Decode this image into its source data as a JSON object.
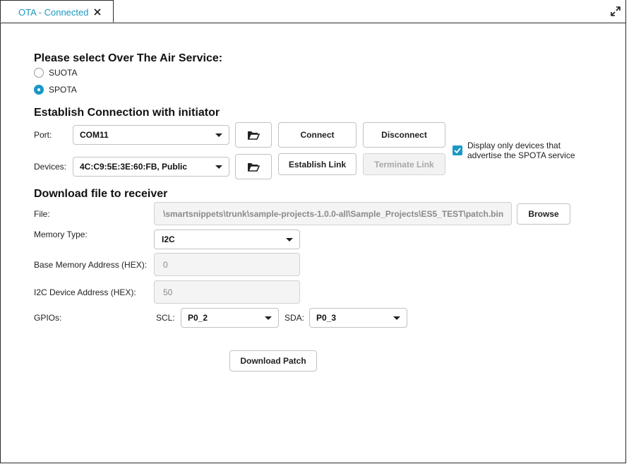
{
  "tab": {
    "title": "OTA - Connected"
  },
  "service": {
    "heading": "Please select Over The Air Service:",
    "options": [
      {
        "label": "SUOTA",
        "selected": false
      },
      {
        "label": "SPOTA",
        "selected": true
      }
    ]
  },
  "connection": {
    "heading": "Establish Connection with initiator",
    "port_label": "Port:",
    "port_value": "COM11",
    "devices_label": "Devices:",
    "devices_value": "4C:C9:5E:3E:60:FB, Public",
    "connect_label": "Connect",
    "disconnect_label": "Disconnect",
    "establish_label": "Establish Link",
    "terminate_label": "Terminate Link",
    "filter_checked": true,
    "filter_line1": "Display only devices that",
    "filter_line2": "advertise the SPOTA service"
  },
  "download": {
    "heading": "Download file to receiver",
    "file_label": "File:",
    "file_value": "\\smartsnippets\\trunk\\sample-projects-1.0.0-all\\Sample_Projects\\ES5_TEST\\patch.bin",
    "browse_label": "Browse",
    "memory_type_label": "Memory Type:",
    "memory_type_value": "I2C",
    "base_address_label": "Base Memory Address (HEX):",
    "base_address_value": "0",
    "i2c_address_label": "I2C Device Address (HEX):",
    "i2c_address_value": "50",
    "gpios_label": "GPIOs:",
    "scl_label": "SCL:",
    "scl_value": "P0_2",
    "sda_label": "SDA:",
    "sda_value": "P0_3",
    "download_label": "Download Patch"
  },
  "colors": {
    "accent": "#1a98c6",
    "border": "#c2c2c2",
    "disabled_bg": "#f2f2f2"
  }
}
